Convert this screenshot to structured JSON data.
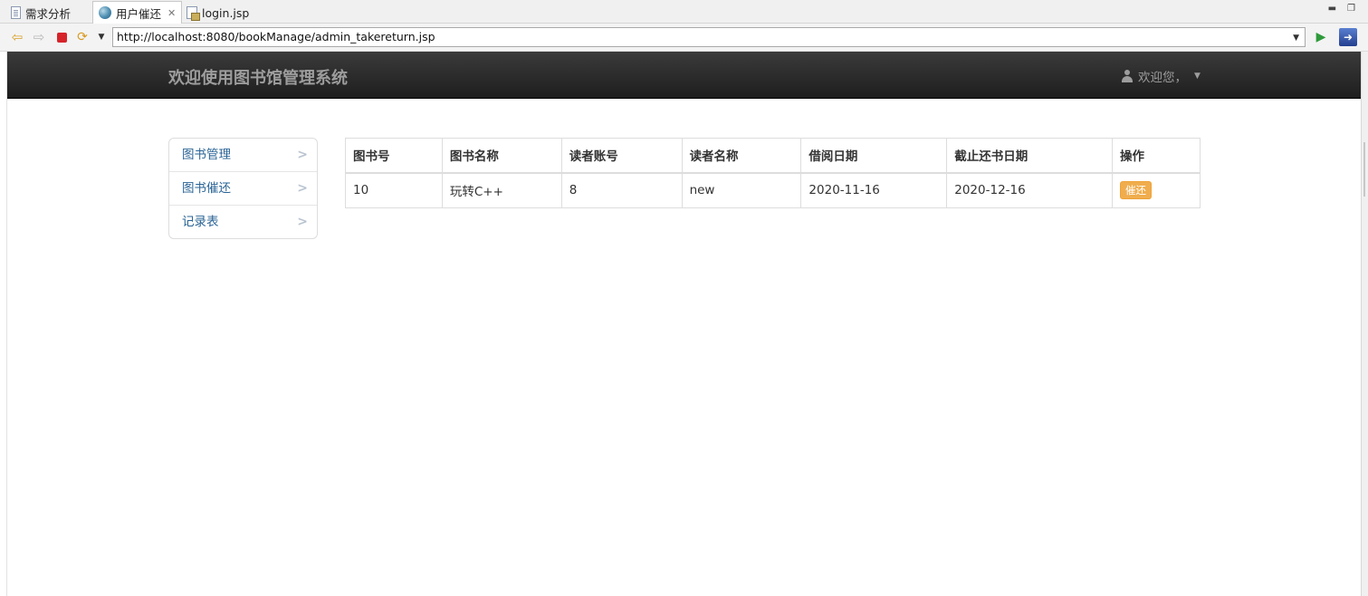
{
  "tabs": [
    {
      "label": "需求分析",
      "icon": "document-icon",
      "active": false
    },
    {
      "label": "用户催还",
      "icon": "globe-icon",
      "active": true
    },
    {
      "label": "login.jsp",
      "icon": "jsp-file-icon",
      "active": false
    }
  ],
  "toolbar": {
    "url": "http://localhost:8080/bookManage/admin_takereturn.jsp"
  },
  "header": {
    "brand": "欢迎使用图书馆管理系统",
    "user_greeting": "欢迎您，"
  },
  "sidebar": {
    "items": [
      {
        "label": "图书管理"
      },
      {
        "label": "图书催还"
      },
      {
        "label": "记录表"
      }
    ]
  },
  "table": {
    "headers": [
      "图书号",
      "图书名称",
      "读者账号",
      "读者名称",
      "借阅日期",
      "截止还书日期",
      "操作"
    ],
    "rows": [
      {
        "book_id": "10",
        "book_name": "玩转C++",
        "reader_account": "8",
        "reader_name": "new",
        "borrow_date": "2020-11-16",
        "due_date": "2020-12-16",
        "action_label": "催还"
      }
    ]
  },
  "colors": {
    "header_bg": "#222222",
    "link": "#2a6496",
    "warning_button": "#f0ad4e"
  }
}
